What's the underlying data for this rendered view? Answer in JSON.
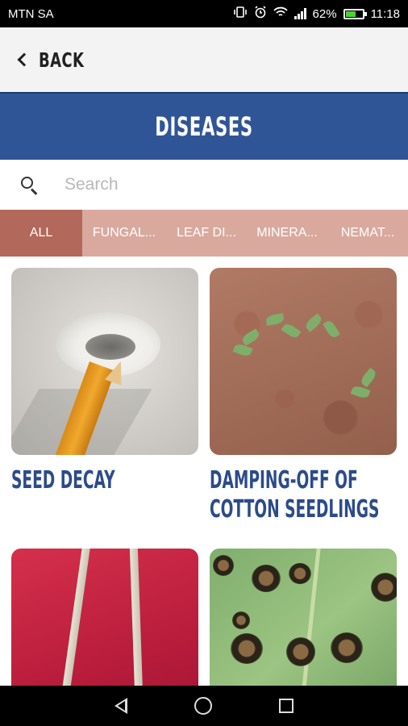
{
  "status_bar": {
    "carrier": "MTN SA",
    "battery_percent": "62%",
    "battery_level": 0.62,
    "time": "11:18",
    "icons": [
      "vibrate-icon",
      "alarm-icon",
      "wifi-icon",
      "signal-icon",
      "battery-icon"
    ]
  },
  "app_bar": {
    "back_label": "BACK"
  },
  "header": {
    "title": "DISEASES",
    "color": "#2f5597"
  },
  "search": {
    "placeholder": "Search",
    "value": ""
  },
  "tabs": [
    {
      "label": "ALL",
      "active": true
    },
    {
      "label": "FUNGAL...",
      "active": false
    },
    {
      "label": "LEAF DI...",
      "active": false
    },
    {
      "label": "MINERA...",
      "active": false
    },
    {
      "label": "NEMAT...",
      "active": false
    }
  ],
  "cards": [
    {
      "title": "SEED DECAY"
    },
    {
      "title": "DAMPING-OFF OF COTTON SEEDLINGS"
    },
    {
      "title": ""
    },
    {
      "title": ""
    }
  ],
  "colors": {
    "tab_bar": "#d9a99e",
    "tab_active": "#b2685a",
    "card_title": "#2b4b8a"
  }
}
